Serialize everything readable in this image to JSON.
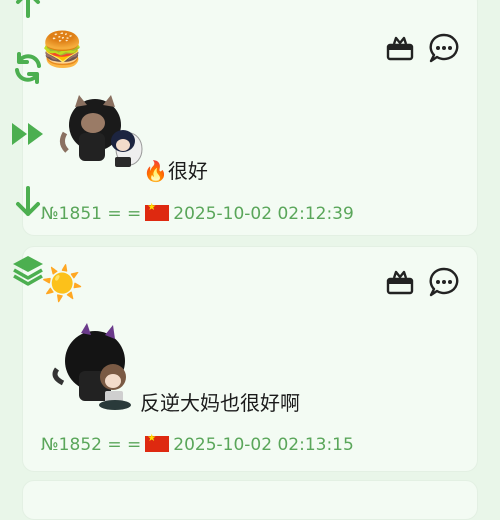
{
  "posts": [
    {
      "emoji": "🍔",
      "text": "🔥很好",
      "number": "№1851",
      "separator": "= =",
      "flag": "cn-flag",
      "timestamp": "2025-10-02 02:12:39"
    },
    {
      "emoji": "☀️",
      "text": "反逆大妈也很好啊",
      "number": "№1852",
      "separator": "= =",
      "flag": "cn-flag",
      "timestamp": "2025-10-02 02:13:15"
    }
  ],
  "icons": {
    "gift": "gift-icon",
    "comment": "chat-bubble-icon",
    "side_buttons": [
      "arrow-up-icon",
      "refresh-icon",
      "fast-forward-icon",
      "arrow-down-icon",
      "layers-icon"
    ]
  },
  "colors": {
    "accent": "#4caf50",
    "meta_text": "#5aa65a",
    "card_bg": "#f3fbf3",
    "page_bg": "#e9f6e9"
  }
}
